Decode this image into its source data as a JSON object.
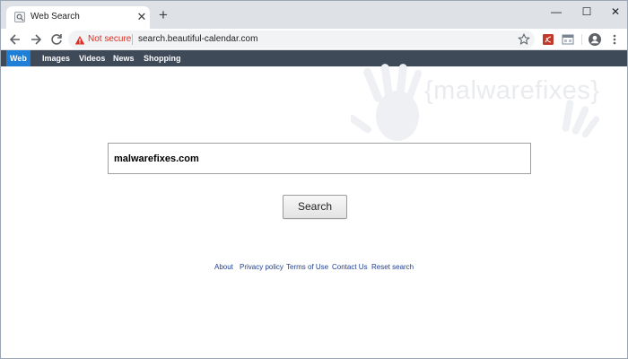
{
  "browser": {
    "tab": {
      "title": "Web Search",
      "favicon": "search-icon",
      "close_glyph": "✕"
    },
    "new_tab_glyph": "+",
    "window_controls": {
      "minimize": "—",
      "maximize": "☐",
      "close": "✕"
    },
    "omnibox": {
      "security_text": "Not secure",
      "url": "search.beautiful-calendar.com"
    }
  },
  "nav": {
    "items": [
      {
        "label": "Web",
        "active": true
      },
      {
        "label": "Images",
        "active": false
      },
      {
        "label": "Videos",
        "active": false
      },
      {
        "label": "News",
        "active": false
      },
      {
        "label": "Shopping",
        "active": false
      }
    ]
  },
  "watermark": {
    "text": "{malwarefixes}"
  },
  "search": {
    "value": "malwarefixes.com",
    "button_label": "Search"
  },
  "footer": {
    "links": [
      "About",
      "Privacy policy",
      "Terms of Use",
      "Contact Us",
      "Reset search"
    ]
  },
  "colors": {
    "navbar_bg": "#3f4a59",
    "active_nav": "#1f7fd6",
    "not_secure": "#d93025",
    "footer_link": "#23408f"
  }
}
